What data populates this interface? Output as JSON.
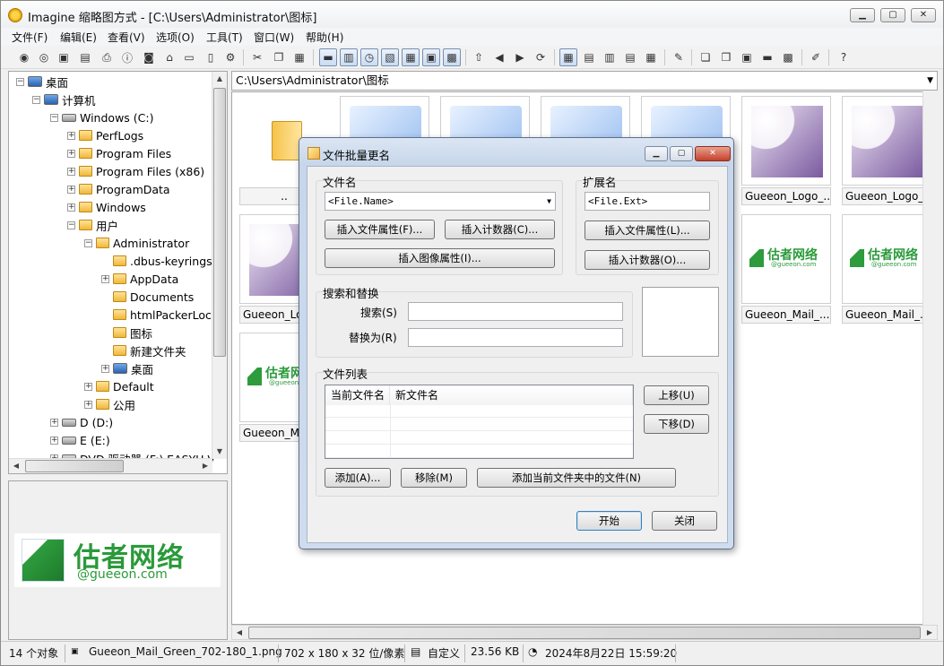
{
  "window": {
    "title": "Imagine 缩略图方式 - [C:\\Users\\Administrator\\图标]"
  },
  "menu": [
    "文件(F)",
    "编辑(E)",
    "查看(V)",
    "选项(O)",
    "工具(T)",
    "窗口(W)",
    "帮助(H)"
  ],
  "tree": [
    {
      "label": "桌面",
      "level": 0,
      "icon": "desktop-icon",
      "expander": "−"
    },
    {
      "label": "计算机",
      "level": 1,
      "icon": "computer-icon",
      "expander": "−"
    },
    {
      "label": "Windows (C:)",
      "level": 2,
      "icon": "drive-icon",
      "expander": "−"
    },
    {
      "label": "PerfLogs",
      "level": 3,
      "icon": "folder-icon",
      "expander": "+"
    },
    {
      "label": "Program Files",
      "level": 3,
      "icon": "folder-icon",
      "expander": "+"
    },
    {
      "label": "Program Files (x86)",
      "level": 3,
      "icon": "folder-icon",
      "expander": "+"
    },
    {
      "label": "ProgramData",
      "level": 3,
      "icon": "folder-icon",
      "expander": "+"
    },
    {
      "label": "Windows",
      "level": 3,
      "icon": "folder-icon",
      "expander": "+"
    },
    {
      "label": "用户",
      "level": 3,
      "icon": "folder-icon",
      "expander": "−"
    },
    {
      "label": "Administrator",
      "level": 4,
      "icon": "folder-icon",
      "expander": "−"
    },
    {
      "label": ".dbus-keyrings",
      "level": 5,
      "icon": "folder-icon",
      "expander": ""
    },
    {
      "label": "AppData",
      "level": 5,
      "icon": "folder-icon",
      "expander": "+"
    },
    {
      "label": "Documents",
      "level": 5,
      "icon": "folder-icon",
      "expander": ""
    },
    {
      "label": "htmlPackerLoca",
      "level": 5,
      "icon": "folder-icon",
      "expander": ""
    },
    {
      "label": "图标",
      "level": 5,
      "icon": "folder-icon",
      "expander": ""
    },
    {
      "label": "新建文件夹",
      "level": 5,
      "icon": "folder-icon",
      "expander": ""
    },
    {
      "label": "桌面",
      "level": 5,
      "icon": "desktop-icon",
      "expander": "+"
    },
    {
      "label": "Default",
      "level": 4,
      "icon": "folder-icon",
      "expander": "+"
    },
    {
      "label": "公用",
      "level": 4,
      "icon": "folder-icon",
      "expander": "+"
    },
    {
      "label": "D (D:)",
      "level": 2,
      "icon": "drive-icon",
      "expander": "+"
    },
    {
      "label": "E (E:)",
      "level": 2,
      "icon": "drive-icon",
      "expander": "+"
    },
    {
      "label": "DVD 驱动器 (F:) EASYU V",
      "level": 2,
      "icon": "dvd-icon",
      "expander": "+"
    }
  ],
  "preview": {
    "logo_cn": "估者网络",
    "logo_en": "@gueeon.com"
  },
  "path": "C:\\Users\\Administrator\\图标",
  "gallery": {
    "row1": [
      "..",
      "",
      "",
      "",
      "",
      "Gueeon_Logo_...",
      "Gueeon_Logo_..."
    ],
    "row2": [
      "Gueeon_Lo",
      "Gueeon_Mail_...",
      "Gueeon_Mail_..."
    ],
    "row3": [
      "Gueeon_M"
    ],
    "thumb_logo_cn": "估者网络",
    "thumb_logo_en": "@gueeon.com",
    "thumb_logo_partial": "估者网"
  },
  "status": {
    "count": "14 个对象",
    "file": "Gueeon_Mail_Green_702-180_1.png",
    "dims": "702 x 180 x 32 位/像素",
    "custom": "自定义",
    "size": "23.56 KB",
    "date": "2024年8月22日 15:59:20"
  },
  "dialog": {
    "title": "文件批量更名",
    "filename_label": "文件名",
    "filename_value": "<File.Name>",
    "insert_file_attr": "插入文件属性(F)...",
    "insert_counter": "插入计数器(C)...",
    "insert_image_attr": "插入图像属性(I)...",
    "ext_label": "扩展名",
    "ext_value": "<File.Ext>",
    "ext_insert_file_attr": "插入文件属性(L)...",
    "ext_insert_counter": "插入计数器(O)...",
    "search_group": "搜索和替换",
    "search_label": "搜索(S)",
    "replace_label": "替换为(R)",
    "filelist_group": "文件列表",
    "col_current": "当前文件名",
    "col_new": "新文件名",
    "move_up": "上移(U)",
    "move_down": "下移(D)",
    "add": "添加(A)...",
    "remove": "移除(M)",
    "add_current": "添加当前文件夹中的文件(N)",
    "start": "开始",
    "close": "关闭"
  }
}
